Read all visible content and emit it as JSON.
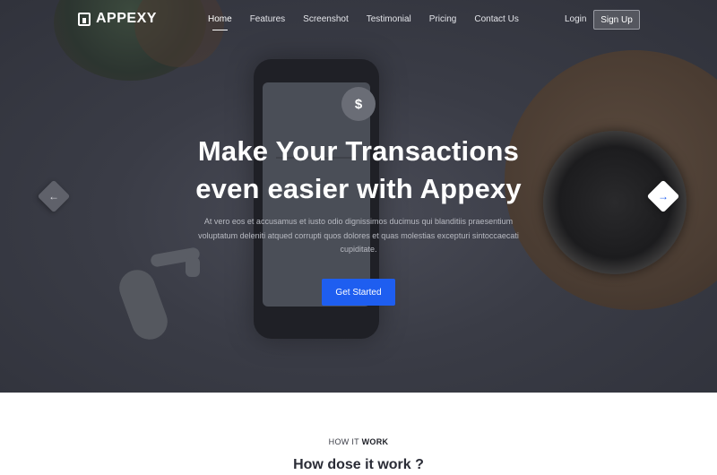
{
  "brand": {
    "name": "APPEXY"
  },
  "nav": {
    "links": [
      {
        "label": "Home",
        "active": true
      },
      {
        "label": "Features",
        "active": false
      },
      {
        "label": "Screenshot",
        "active": false
      },
      {
        "label": "Testimonial",
        "active": false
      },
      {
        "label": "Pricing",
        "active": false
      },
      {
        "label": "Contact Us",
        "active": false
      }
    ],
    "login_label": "Login",
    "signup_label": "Sign Up"
  },
  "hero": {
    "title_line1": "Make Your Transactions",
    "title_line2": "even easier with Appexy",
    "description": "At vero eos et accusamus et iusto odio dignissimos ducimus qui blanditiis praesentium voluptatum deleniti atqued corrupti quos dolores et quas molestias excepturi sintoccaecati cupiditate.",
    "cta_label": "Get Started",
    "badge_symbol": "$",
    "prev_icon": "arrow-left-icon",
    "next_icon": "arrow-right-icon",
    "prev_glyph": "←",
    "next_glyph": "→"
  },
  "section": {
    "tag_light": "HOW IT ",
    "tag_bold": "WORK",
    "title": "How dose it work ?"
  },
  "colors": {
    "accent": "#1e5ef0",
    "hero_overlay": "#3a3c46",
    "text_light": "#ffffff"
  }
}
